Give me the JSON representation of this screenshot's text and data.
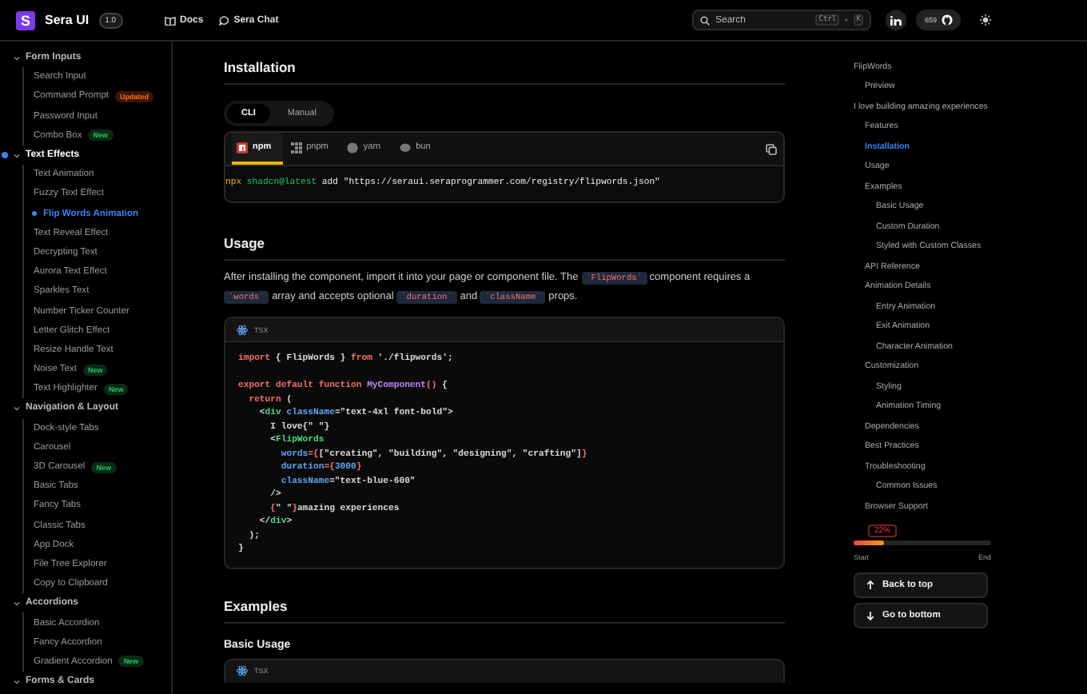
{
  "header": {
    "logo_letter": "S",
    "brand": "Sera UI",
    "version": "1.0",
    "nav": [
      {
        "label": "Docs",
        "kind": "book"
      },
      {
        "label": "Sera Chat",
        "kind": "chat"
      }
    ],
    "search": {
      "placeholder": "Search",
      "keys": [
        "Ctrl",
        "+",
        "K"
      ]
    },
    "github_stars": "659"
  },
  "sidebar": {
    "groups": [
      {
        "label": "Form Inputs",
        "expanded": true,
        "selected": false,
        "items": [
          {
            "label": "Search Input",
            "selected": false
          },
          {
            "label": "Command Prompt",
            "selected": false,
            "badge": {
              "text": "Updated",
              "kind": "updated"
            }
          },
          {
            "label": "Password Input",
            "selected": false
          },
          {
            "label": "Combo Box",
            "selected": false,
            "badge": {
              "text": "New",
              "kind": "new"
            }
          }
        ]
      },
      {
        "label": "Text Effects",
        "expanded": true,
        "selected": true,
        "items": [
          {
            "label": "Text Animation",
            "selected": false
          },
          {
            "label": "Fuzzy Text Effect",
            "selected": false
          },
          {
            "label": "Flip Words Animation",
            "selected": true
          },
          {
            "label": "Text Reveal Effect",
            "selected": false
          },
          {
            "label": "Decrypting Text",
            "selected": false
          },
          {
            "label": "Aurora Text Effect",
            "selected": false
          },
          {
            "label": "Sparkles Text",
            "selected": false
          },
          {
            "label": "Number Ticker Counter",
            "selected": false
          },
          {
            "label": "Letter Glitch Effect",
            "selected": false
          },
          {
            "label": "Resize Handle Text",
            "selected": false
          },
          {
            "label": "Noise Text",
            "selected": false,
            "badge": {
              "text": "New",
              "kind": "new"
            }
          },
          {
            "label": "Text Highlighter",
            "selected": false,
            "badge": {
              "text": "New",
              "kind": "new"
            }
          }
        ]
      },
      {
        "label": "Navigation & Layout",
        "expanded": true,
        "selected": false,
        "items": [
          {
            "label": "Dock-style Tabs",
            "selected": false
          },
          {
            "label": "Carousel",
            "selected": false
          },
          {
            "label": "3D Carousel",
            "selected": false,
            "badge": {
              "text": "New",
              "kind": "new"
            }
          },
          {
            "label": "Basic Tabs",
            "selected": false
          },
          {
            "label": "Fancy Tabs",
            "selected": false
          },
          {
            "label": "Classic Tabs",
            "selected": false
          },
          {
            "label": "App Dock",
            "selected": false
          },
          {
            "label": "File Tree Explorer",
            "selected": false
          },
          {
            "label": "Copy to Clipboard",
            "selected": false
          }
        ]
      },
      {
        "label": "Accordions",
        "expanded": true,
        "selected": false,
        "items": [
          {
            "label": "Basic Accordion",
            "selected": false
          },
          {
            "label": "Fancy Accordion",
            "selected": false
          },
          {
            "label": "Gradient Accordion",
            "selected": false,
            "badge": {
              "text": "New",
              "kind": "new"
            }
          }
        ]
      },
      {
        "label": "Forms & Cards",
        "expanded": true,
        "selected": false
      }
    ]
  },
  "installation": {
    "title": "Installation",
    "modes": [
      {
        "label": "CLI",
        "selected": true
      },
      {
        "label": "Manual",
        "selected": false
      }
    ],
    "managers": [
      {
        "label": "npm",
        "kind": "npm",
        "selected": true
      },
      {
        "label": "pnpm",
        "kind": "pnpm",
        "selected": false
      },
      {
        "label": "yarn",
        "kind": "yarn",
        "selected": false
      },
      {
        "label": "bun",
        "kind": "bun",
        "selected": false
      }
    ],
    "command": [
      {
        "kind": "runner",
        "text": "npx"
      },
      {
        "kind": "package",
        "text": "shadcn@latest"
      },
      {
        "kind": "plain",
        "text": "add \"https://seraui.seraprogrammer.com/registry/flipwords.json\""
      }
    ]
  },
  "usage": {
    "title": "Usage",
    "paragraph": [
      {
        "kind": "text",
        "text": "After installing the component, import it into your page or component file. The "
      },
      {
        "kind": "code",
        "text": "`FlipWords`"
      },
      {
        "kind": "text",
        "text": " component requires a "
      },
      {
        "kind": "code",
        "text": "`words`"
      },
      {
        "kind": "text",
        "text": " array and accepts optional "
      },
      {
        "kind": "code",
        "text": "`duration`"
      },
      {
        "kind": "text",
        "text": " and "
      },
      {
        "kind": "code",
        "text": "`className`"
      },
      {
        "kind": "text",
        "text": " props."
      }
    ],
    "code_language": "TSX",
    "code": [
      [
        {
          "kind": "keyword",
          "text": "import"
        },
        {
          "kind": "plain",
          "text": " { FlipWords } "
        },
        {
          "kind": "keyword",
          "text": "from"
        },
        {
          "kind": "plain",
          "text": " './flipwords';"
        }
      ],
      [
        {
          "kind": "blank"
        }
      ],
      [
        {
          "kind": "keyword",
          "text": "export default function "
        },
        {
          "kind": "function",
          "text": "MyComponent"
        },
        {
          "kind": "punct",
          "text": "()"
        },
        {
          "kind": "plain",
          "text": " {"
        }
      ],
      [
        {
          "kind": "keyword",
          "text": "  return"
        },
        {
          "kind": "plain",
          "text": " ("
        }
      ],
      [
        {
          "kind": "plain",
          "text": "    <"
        },
        {
          "kind": "tag",
          "text": "div"
        },
        {
          "kind": "attr",
          "text": " className"
        },
        {
          "kind": "plain",
          "text": "=\"text-4xl font-bold\">"
        }
      ],
      [
        {
          "kind": "plain",
          "text": "      I love{\" \"}"
        }
      ],
      [
        {
          "kind": "plain",
          "text": "      <"
        },
        {
          "kind": "tag",
          "text": "FlipWords"
        }
      ],
      [
        {
          "kind": "attr",
          "text": "        words"
        },
        {
          "kind": "punct",
          "text": "={"
        },
        {
          "kind": "plain",
          "text": "[\"creating\", \"building\", \"designing\", \"crafting\"]"
        },
        {
          "kind": "punct",
          "text": "}"
        }
      ],
      [
        {
          "kind": "attr",
          "text": "        duration"
        },
        {
          "kind": "punct",
          "text": "={"
        },
        {
          "kind": "attr",
          "text": "3000"
        },
        {
          "kind": "punct",
          "text": "}"
        }
      ],
      [
        {
          "kind": "attr",
          "text": "        className"
        },
        {
          "kind": "plain",
          "text": "=\"text-blue-600\""
        }
      ],
      [
        {
          "kind": "plain",
          "text": "      />"
        }
      ],
      [
        {
          "kind": "punct",
          "text": "      {"
        },
        {
          "kind": "plain",
          "text": "\" \""
        },
        {
          "kind": "punct",
          "text": "}"
        },
        {
          "kind": "plain",
          "text": "amazing experiences"
        }
      ],
      [
        {
          "kind": "plain",
          "text": "    </"
        },
        {
          "kind": "tag",
          "text": "div"
        },
        {
          "kind": "plain",
          "text": ">"
        }
      ],
      [
        {
          "kind": "plain",
          "text": "  );"
        }
      ],
      [
        {
          "kind": "plain",
          "text": "}"
        }
      ]
    ]
  },
  "examples": {
    "title": "Examples",
    "subtitle": "Basic Usage",
    "code_language": "TSX"
  },
  "toc": {
    "items": [
      {
        "label": "FlipWords",
        "selected": false,
        "children": [
          {
            "label": "Preview",
            "selected": false
          }
        ]
      },
      {
        "label": "I love building amazing experiences",
        "selected": false,
        "children": [
          {
            "label": "Features",
            "selected": false
          },
          {
            "label": "Installation",
            "selected": true
          },
          {
            "label": "Usage",
            "selected": false
          },
          {
            "label": "Examples",
            "selected": false,
            "children": [
              {
                "label": "Basic Usage",
                "selected": false
              },
              {
                "label": "Custom Duration",
                "selected": false
              },
              {
                "label": "Styled with Custom Classes",
                "selected": false
              }
            ]
          },
          {
            "label": "API Reference",
            "selected": false
          },
          {
            "label": "Animation Details",
            "selected": false,
            "children": [
              {
                "label": "Entry Animation",
                "selected": false
              },
              {
                "label": "Exit Animation",
                "selected": false
              },
              {
                "label": "Character Animation",
                "selected": false
              }
            ]
          },
          {
            "label": "Customization",
            "selected": false,
            "children": [
              {
                "label": "Styling",
                "selected": false
              },
              {
                "label": "Animation Timing",
                "selected": false
              }
            ]
          },
          {
            "label": "Dependencies",
            "selected": false
          },
          {
            "label": "Best Practices",
            "selected": false
          },
          {
            "label": "Troubleshooting",
            "selected": false,
            "children": [
              {
                "label": "Common Issues",
                "selected": false
              }
            ]
          },
          {
            "label": "Browser Support",
            "selected": false
          }
        ]
      }
    ],
    "progress": {
      "label": "22%",
      "level": 0.22,
      "start": "Start",
      "end": "End"
    },
    "buttons": [
      {
        "label": "Back to top",
        "kind": "up"
      },
      {
        "label": "Go to bottom",
        "kind": "down"
      }
    ]
  }
}
